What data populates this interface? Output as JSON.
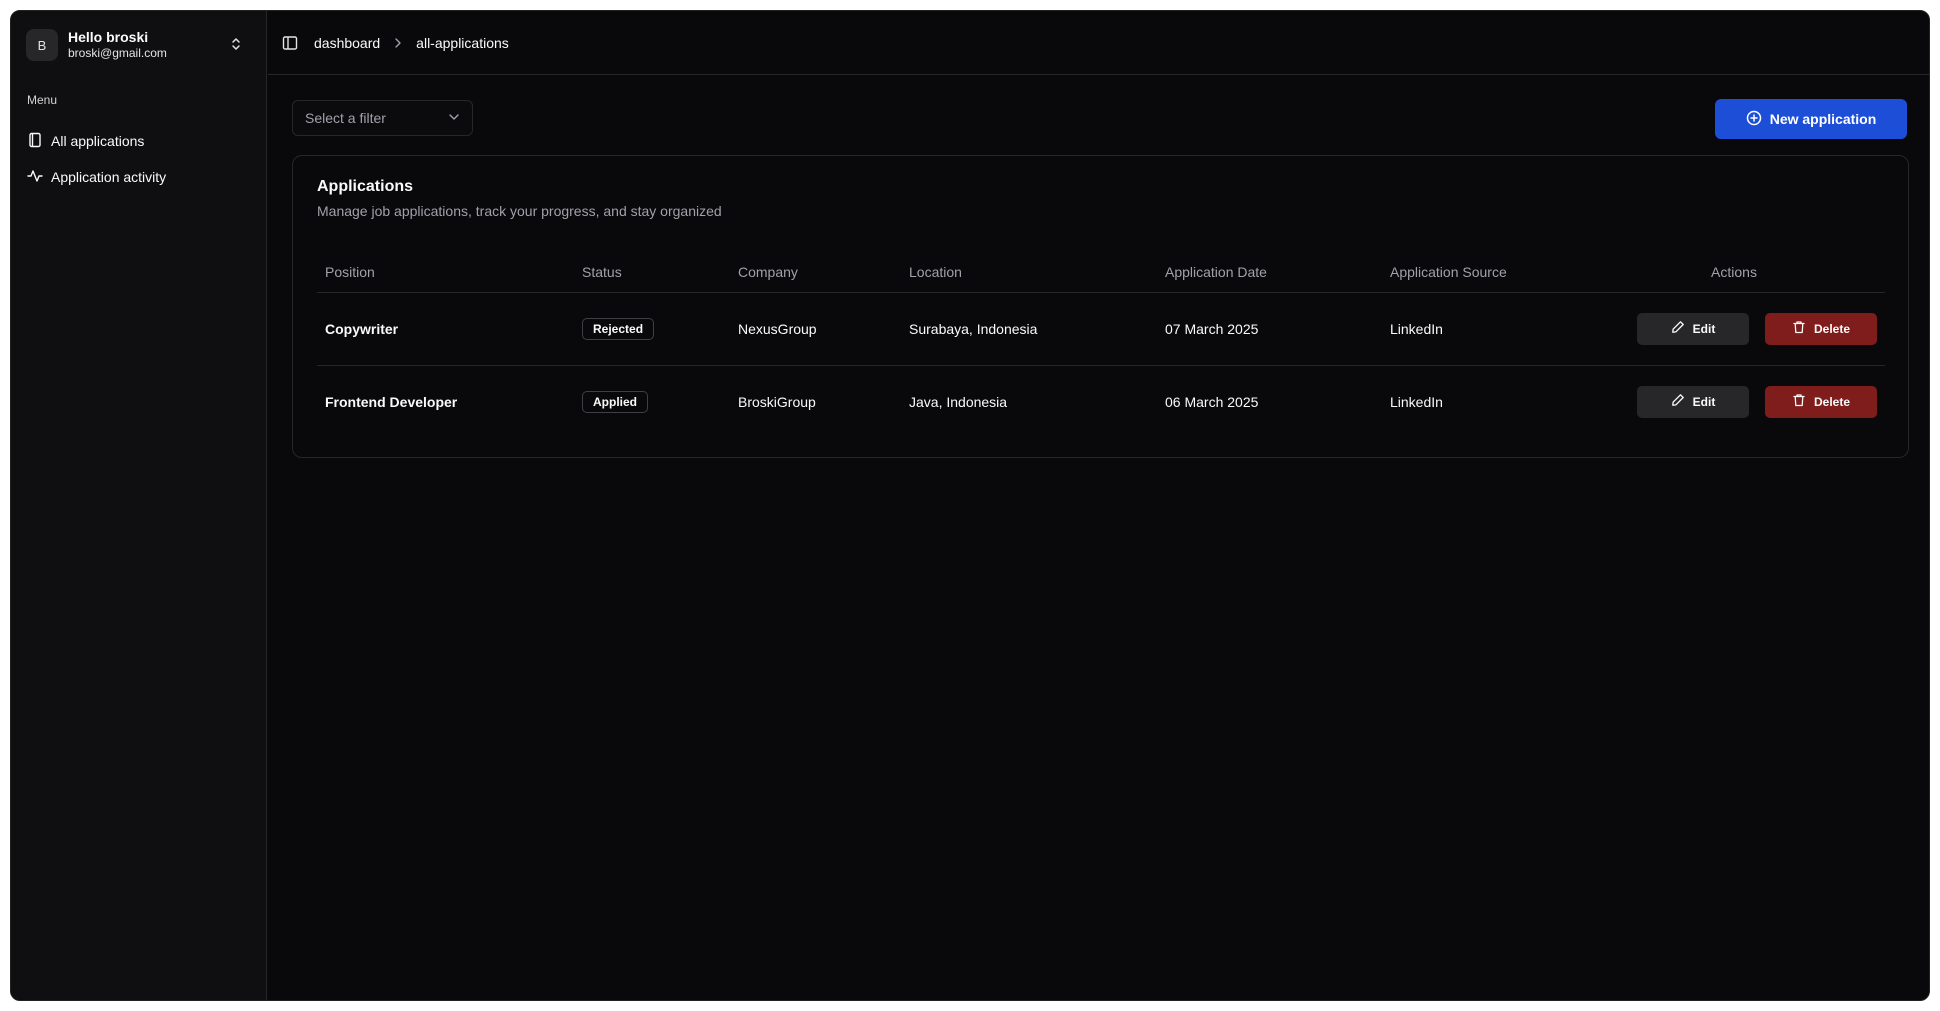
{
  "user": {
    "initial": "B",
    "name": "Hello broski",
    "email": "broski@gmail.com"
  },
  "sidebar": {
    "menu_label": "Menu",
    "items": [
      {
        "label": "All applications",
        "icon": "book-icon"
      },
      {
        "label": "Application activity",
        "icon": "activity-icon"
      }
    ]
  },
  "breadcrumb": {
    "items": [
      "dashboard",
      "all-applications"
    ]
  },
  "toolbar": {
    "filter_placeholder": "Select a filter",
    "new_button_label": "New application"
  },
  "card": {
    "title": "Applications",
    "description": "Manage job applications, track your progress, and stay organized"
  },
  "table": {
    "columns": [
      "Position",
      "Status",
      "Company",
      "Location",
      "Application Date",
      "Application Source",
      "Actions"
    ],
    "rows": [
      {
        "position": "Copywriter",
        "status": "Rejected",
        "company": "NexusGroup",
        "location": "Surabaya, Indonesia",
        "date": "07 March 2025",
        "source": "LinkedIn"
      },
      {
        "position": "Frontend Developer",
        "status": "Applied",
        "company": "BroskiGroup",
        "location": "Java, Indonesia",
        "date": "06 March 2025",
        "source": "LinkedIn"
      }
    ],
    "edit_label": "Edit",
    "delete_label": "Delete"
  },
  "colors": {
    "background": "#09090b",
    "primary": "#1d4ed8",
    "danger": "#7f1d1d",
    "border": "#27272a"
  }
}
